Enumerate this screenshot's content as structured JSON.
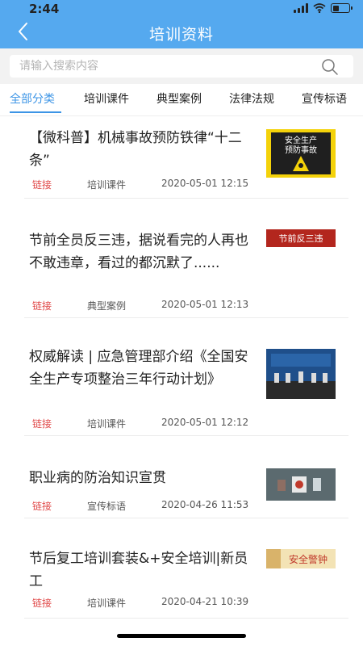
{
  "status": {
    "time": "2:44"
  },
  "header": {
    "title": "培训资料"
  },
  "search": {
    "placeholder": "请输入搜索内容"
  },
  "tabs": [
    "全部分类",
    "培训课件",
    "典型案例",
    "法律法规",
    "宣传标语"
  ],
  "items": [
    {
      "title": "【微科普】机械事故预防铁律“十二条”",
      "link": "链接",
      "category": "培训课件",
      "time": "2020-05-01 12:15",
      "thumb_text": [
        "安全生产",
        "预防事故"
      ]
    },
    {
      "title": "节前全员反三违，据说看完的人再也不敢违章，看过的都沉默了......",
      "link": "链接",
      "category": "典型案例",
      "time": "2020-05-01 12:13",
      "thumb_text": [
        "节前反三违"
      ]
    },
    {
      "title": "权威解读 | 应急管理部介绍《全国安全生产专项整治三年行动计划》",
      "link": "链接",
      "category": "培训课件",
      "time": "2020-05-01 12:12",
      "thumb_text": []
    },
    {
      "title": "职业病的防治知识宣贯",
      "link": "链接",
      "category": "宣传标语",
      "time": "2020-04-26 11:53",
      "thumb_text": []
    },
    {
      "title": "节后复工培训套装&+安全培训|新员工",
      "link": "链接",
      "category": "培训课件",
      "time": "2020-04-21 10:39",
      "thumb_text": [
        "安全警钟"
      ]
    }
  ],
  "colors": {
    "header": "#55a9ef",
    "accent": "#3d95e6",
    "link": "#e04848"
  }
}
